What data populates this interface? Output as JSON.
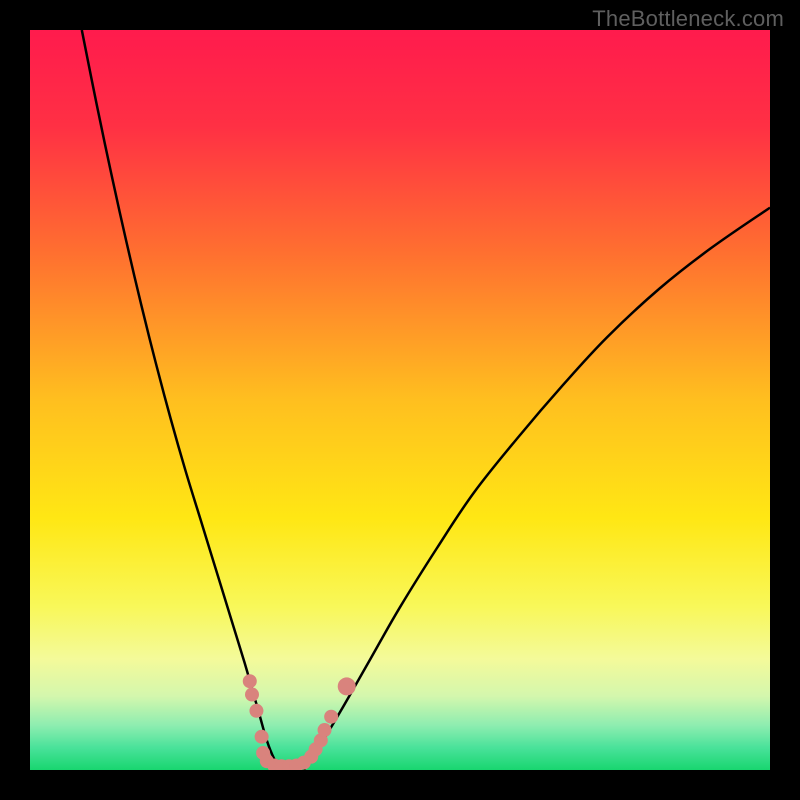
{
  "watermark": "TheBottleneck.com",
  "chart_data": {
    "type": "line",
    "title": "",
    "xlabel": "",
    "ylabel": "",
    "xlim": [
      0,
      100
    ],
    "ylim": [
      0,
      100
    ],
    "grid": false,
    "gradient_stops": [
      {
        "offset": 0.0,
        "color": "#ff1b4d"
      },
      {
        "offset": 0.13,
        "color": "#ff3044"
      },
      {
        "offset": 0.3,
        "color": "#ff6f30"
      },
      {
        "offset": 0.5,
        "color": "#ffbf1f"
      },
      {
        "offset": 0.66,
        "color": "#ffe714"
      },
      {
        "offset": 0.78,
        "color": "#f8f85a"
      },
      {
        "offset": 0.85,
        "color": "#f4fa9a"
      },
      {
        "offset": 0.9,
        "color": "#d4f7ad"
      },
      {
        "offset": 0.94,
        "color": "#8dedb0"
      },
      {
        "offset": 0.97,
        "color": "#49e29a"
      },
      {
        "offset": 1.0,
        "color": "#18d66f"
      }
    ],
    "curve_left": {
      "x": [
        7,
        9,
        11,
        13,
        15,
        17,
        19,
        21,
        23,
        25,
        27,
        29,
        30,
        31,
        32,
        33,
        34
      ],
      "y": [
        100,
        90,
        80.5,
        71.5,
        63,
        55,
        47.5,
        40.5,
        34,
        27.5,
        21,
        14.5,
        11,
        7.5,
        4,
        1.5,
        0
      ]
    },
    "curve_right": {
      "x": [
        37,
        39,
        42,
        46,
        50,
        55,
        60,
        66,
        72,
        78,
        85,
        92,
        100
      ],
      "y": [
        0,
        3,
        8,
        15,
        22,
        30,
        37.5,
        45,
        52,
        58.5,
        65,
        70.5,
        76
      ]
    },
    "markers": {
      "color": "#d9837d",
      "radius_small": 7,
      "radius_large": 9,
      "points": [
        {
          "x": 29.7,
          "y": 12.0
        },
        {
          "x": 30.0,
          "y": 10.2
        },
        {
          "x": 30.6,
          "y": 8.0
        },
        {
          "x": 31.3,
          "y": 4.5
        },
        {
          "x": 31.5,
          "y": 2.3
        },
        {
          "x": 32.0,
          "y": 1.2
        },
        {
          "x": 33.0,
          "y": 0.6
        },
        {
          "x": 34.0,
          "y": 0.5
        },
        {
          "x": 35.0,
          "y": 0.5
        },
        {
          "x": 36.0,
          "y": 0.6
        },
        {
          "x": 37.0,
          "y": 1.0
        },
        {
          "x": 38.0,
          "y": 1.8
        },
        {
          "x": 38.6,
          "y": 2.8
        },
        {
          "x": 39.3,
          "y": 4.0
        },
        {
          "x": 39.8,
          "y": 5.4
        },
        {
          "x": 40.7,
          "y": 7.2
        },
        {
          "x": 42.8,
          "y": 11.3
        }
      ]
    }
  }
}
